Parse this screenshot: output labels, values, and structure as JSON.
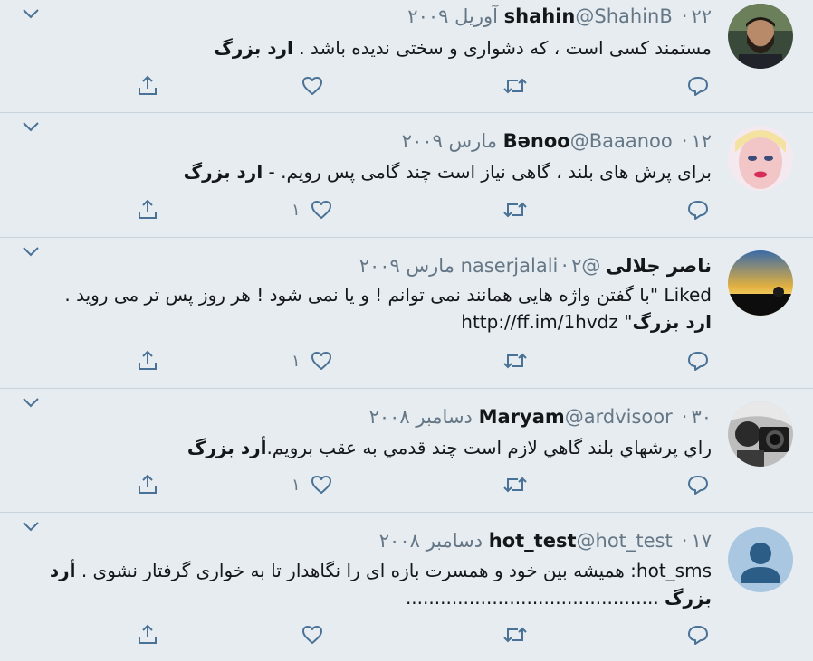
{
  "tweets": [
    {
      "name": "shahin",
      "handle": "@ShahinB",
      "date": "۲۲ آوریل ۲۰۰۹",
      "text": "مستمند کسی است ، که دشواری و سختی ندیده باشد . ",
      "tag": "ارد بزرگ",
      "text_after": "",
      "like_count": "",
      "avatar": "bearded-man-photo"
    },
    {
      "name": "Bənoo",
      "handle": "@Baaanoo",
      "date": "۱۲ مارس ۲۰۰۹",
      "text": "برای پرش های بلند ، گاهی نیاز است چند گامی پس رویم. - ",
      "tag": "ارد بزرگ",
      "text_after": "",
      "like_count": "۱",
      "avatar": "doll-face-photo"
    },
    {
      "name": "ناصر جلالی",
      "handle": "@naserjalali",
      "date": "۲ مارس ۲۰۰۹",
      "text": "Liked \"با گفتن واژه هایی همانند نمی توانم ! و یا نمی شود ! هر روز پس تر می روید . ",
      "tag": "ارد بزرگ",
      "text_after": "\" http://ff.im/1hvdz",
      "like_count": "۱",
      "avatar": "sunset-photo"
    },
    {
      "name": "Maryam",
      "handle": "@ardvisoor",
      "date": "۳۰ دسامبر ۲۰۰۸",
      "text": "راي پرشهاي بلند گاهي لازم است چند قدمي به عقب برويم.",
      "tag": "أرد بزرگ",
      "text_after": "",
      "like_count": "۱",
      "avatar": "camera-photo"
    },
    {
      "name": "hot_test",
      "handle": "@hot_test",
      "date": "۱۷ دسامبر ۲۰۰۸",
      "text": "hot_sms: همیشه بین خود و همسرت بازه ای را نگاهدار تا به خواری گرفتار نشوی . ",
      "tag": "أرد بزرگ",
      "text_after": " ............................................",
      "like_count": "",
      "avatar": "default-user-avatar"
    }
  ],
  "separator": "·",
  "colors": {
    "background": "#e6ecf0",
    "text": "#14171a",
    "secondary": "#657786",
    "icon": "#4a7296",
    "divider": "#c9d3db"
  }
}
